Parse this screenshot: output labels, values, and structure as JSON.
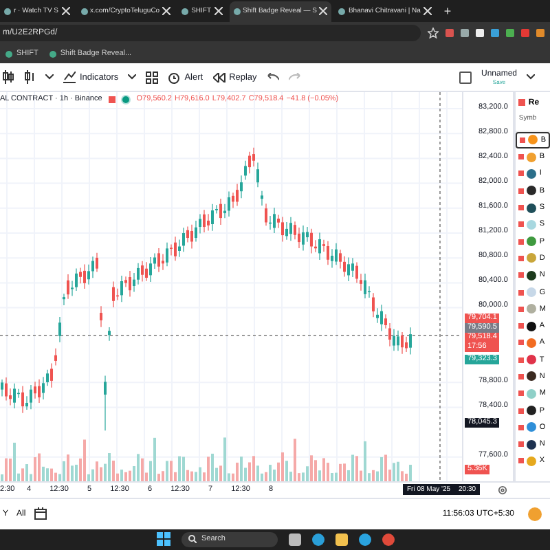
{
  "browser": {
    "tabs": [
      {
        "title": "r · Watch TV S",
        "selected": false
      },
      {
        "title": "x.com/CryptoTeluguCo",
        "selected": false
      },
      {
        "title": "SHIFT",
        "selected": false
      },
      {
        "title": "Shift Badge Reveal — S",
        "selected": true
      },
      {
        "title": "Bhanavi Chitravani | Na",
        "selected": false
      }
    ],
    "new_tab": "+",
    "address": "m/U2E2RPGd/",
    "bookmarks": [
      "SHIFT",
      "Shift Badge Reveal..."
    ]
  },
  "toolbar": {
    "indicators": "Indicators",
    "alert": "Alert",
    "replay": "Replay",
    "layout_name": "Unnamed",
    "layout_status": "Save",
    "layout_checked": false
  },
  "legend": {
    "symbol": "AL CONTRACT · 1h · Binance",
    "open": "O79,560.2",
    "high": "H79,616.0",
    "low": "L79,402.7",
    "close": "C79,518.4",
    "change": "−41.8 (−0.05%)"
  },
  "price_axis": {
    "ticks": [
      "83,200.0",
      "82,800.0",
      "82,400.0",
      "82,000.0",
      "81,600.0",
      "81,200.0",
      "80,800.0",
      "80,400.0",
      "80,000.0",
      "78,800.0",
      "78,400.0",
      "77,600.0"
    ],
    "tags": [
      {
        "text": "79,704.1",
        "color": "#ef5350"
      },
      {
        "text": "79,590.5",
        "color": "#787b86"
      },
      {
        "text": "79,518.4",
        "sub": "17:56",
        "color": "#ef5350"
      },
      {
        "text": "79,323.3",
        "color": "#26a69a"
      },
      {
        "text": "78,045.3",
        "color": "#131722"
      }
    ],
    "volume": "5.36K"
  },
  "time_axis": {
    "labels": [
      "2:30",
      "4",
      "12:30",
      "5",
      "12:30",
      "6",
      "12:30",
      "7",
      "12:30",
      "8"
    ],
    "cursor_date": "Fri 08 May '25",
    "cursor_time": "20:30"
  },
  "watchlist": {
    "header": "Re",
    "column": "Symb",
    "rows": [
      {
        "letter": "B",
        "color": "#f7931a",
        "selected": true
      },
      {
        "letter": "B",
        "color": "#f0a030",
        "selected": false
      },
      {
        "letter": "I",
        "color": "#2b6f8a",
        "selected": false
      },
      {
        "letter": "B",
        "color": "#2a2a2a",
        "selected": false
      },
      {
        "letter": "S",
        "color": "#1f4f5a",
        "selected": false
      },
      {
        "letter": "S",
        "color": "#a8d8e0",
        "selected": false
      },
      {
        "letter": "P",
        "color": "#3f9a3f",
        "selected": false
      },
      {
        "letter": "D",
        "color": "#c9a63a",
        "selected": false
      },
      {
        "letter": "N",
        "color": "#1d3b1d",
        "selected": false
      },
      {
        "letter": "G",
        "color": "#c7d8e8",
        "selected": false
      },
      {
        "letter": "M",
        "color": "#b0b0a0",
        "selected": false
      },
      {
        "letter": "A",
        "color": "#111111",
        "selected": false
      },
      {
        "letter": "A",
        "color": "#f26c22",
        "selected": false
      },
      {
        "letter": "T",
        "color": "#e0334a",
        "selected": false
      },
      {
        "letter": "N",
        "color": "#3a2a20",
        "selected": false
      },
      {
        "letter": "M",
        "color": "#8fd0c8",
        "selected": false
      },
      {
        "letter": "P",
        "color": "#222222",
        "selected": false
      },
      {
        "letter": "O",
        "color": "#2f8fd8",
        "selected": false
      },
      {
        "letter": "N",
        "color": "#1e3250",
        "selected": false
      },
      {
        "letter": "X",
        "color": "#e6a91e",
        "selected": false
      }
    ]
  },
  "bottom_bar": {
    "ranges": [
      "Y",
      "All"
    ],
    "clock": "11:56:03 UTC+5:30"
  },
  "taskbar": {
    "search": "Search"
  }
}
